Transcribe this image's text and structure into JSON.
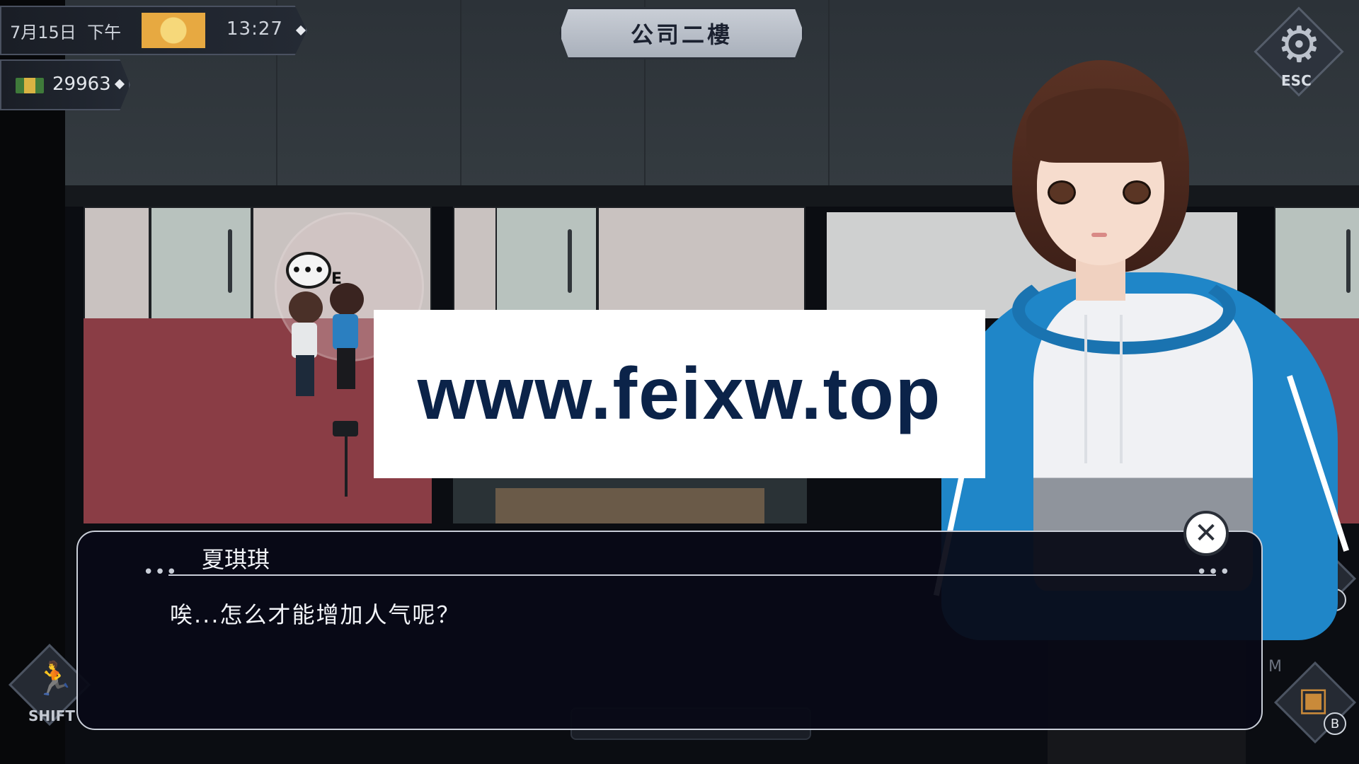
{
  "hud": {
    "date": "7月15日",
    "period": "下午",
    "weather_icon": "sun-icon",
    "time": "13:27",
    "money": "29963",
    "money_icon": "cash-icon"
  },
  "location": {
    "name": "公司二樓"
  },
  "settings": {
    "key_label": "ESC",
    "icon": "gear-icon"
  },
  "actions": {
    "run": {
      "icon": "running-figure-icon",
      "key_label": "SHIFT"
    },
    "quest": {
      "icon": "clipboard-alert-icon",
      "key_label": "I"
    },
    "inventory": {
      "icon": "backpack-icon",
      "key_label": "B"
    },
    "hidden_key": "M"
  },
  "scene": {
    "interact_key": "E",
    "interact_icon": "speech-bubble-icon"
  },
  "watermark": {
    "text": "www.feixw.top"
  },
  "dialog": {
    "speaker": "夏琪琪",
    "line": "唉...怎么才能增加人气呢？",
    "close_icon": "close-icon"
  },
  "colors": {
    "hoodie": "#1f86c8",
    "dialog_bg": "#080a16",
    "floor": "#8a3d45"
  }
}
